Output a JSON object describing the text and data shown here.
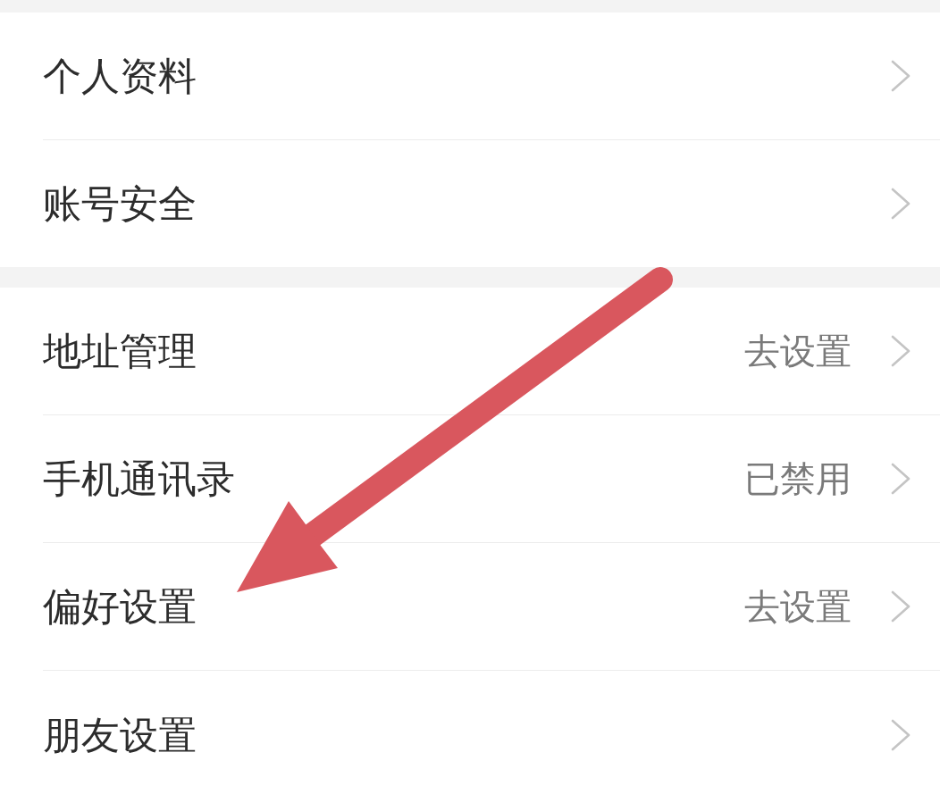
{
  "groups": [
    {
      "items": [
        {
          "label": "个人资料"
        },
        {
          "label": "账号安全"
        }
      ]
    },
    {
      "items": [
        {
          "label": "地址管理",
          "value": "去设置"
        },
        {
          "label": "手机通讯录",
          "value": "已禁用"
        },
        {
          "label": "偏好设置",
          "value": "去设置"
        },
        {
          "label": "朋友设置"
        }
      ]
    }
  ]
}
